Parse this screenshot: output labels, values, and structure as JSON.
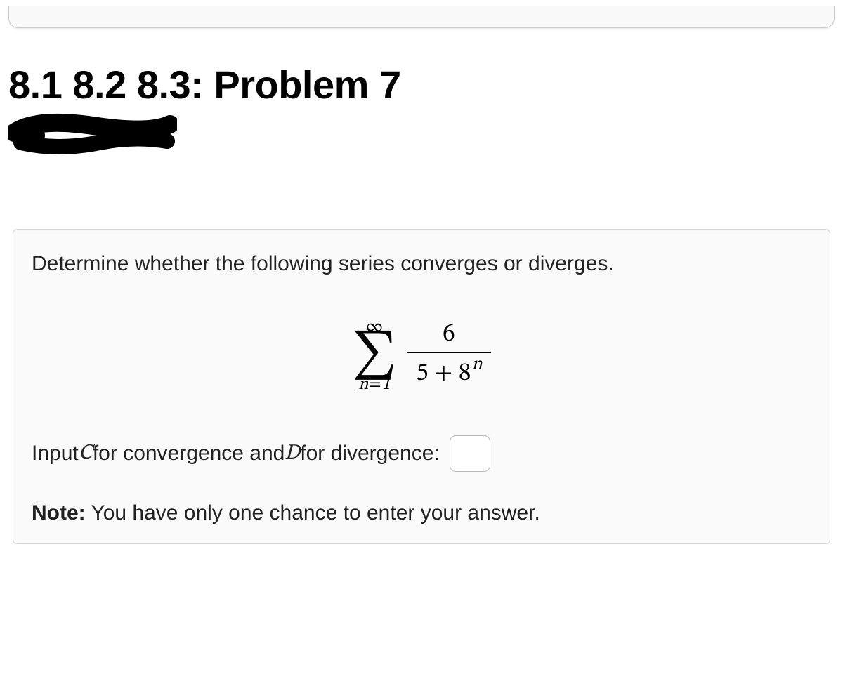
{
  "header": {
    "title": "8.1 8.2 8.3: Problem 7"
  },
  "problem": {
    "prompt": "Determine whether the following series converges or diverges.",
    "math": {
      "sigma_upper": "∞",
      "sigma_lower_var": "n",
      "sigma_lower_eq": "=",
      "sigma_lower_val": "1",
      "numerator": "6",
      "denom_const": "5",
      "denom_plus": " + ",
      "denom_base": "8",
      "denom_exp": "n"
    },
    "answer_prefix": "Input ",
    "answer_c": "C",
    "answer_mid1": " for convergence and ",
    "answer_d": "D",
    "answer_mid2": " for divergence: ",
    "input_value": "",
    "note_label": "Note:",
    "note_text": " You have only one chance to enter your answer."
  }
}
